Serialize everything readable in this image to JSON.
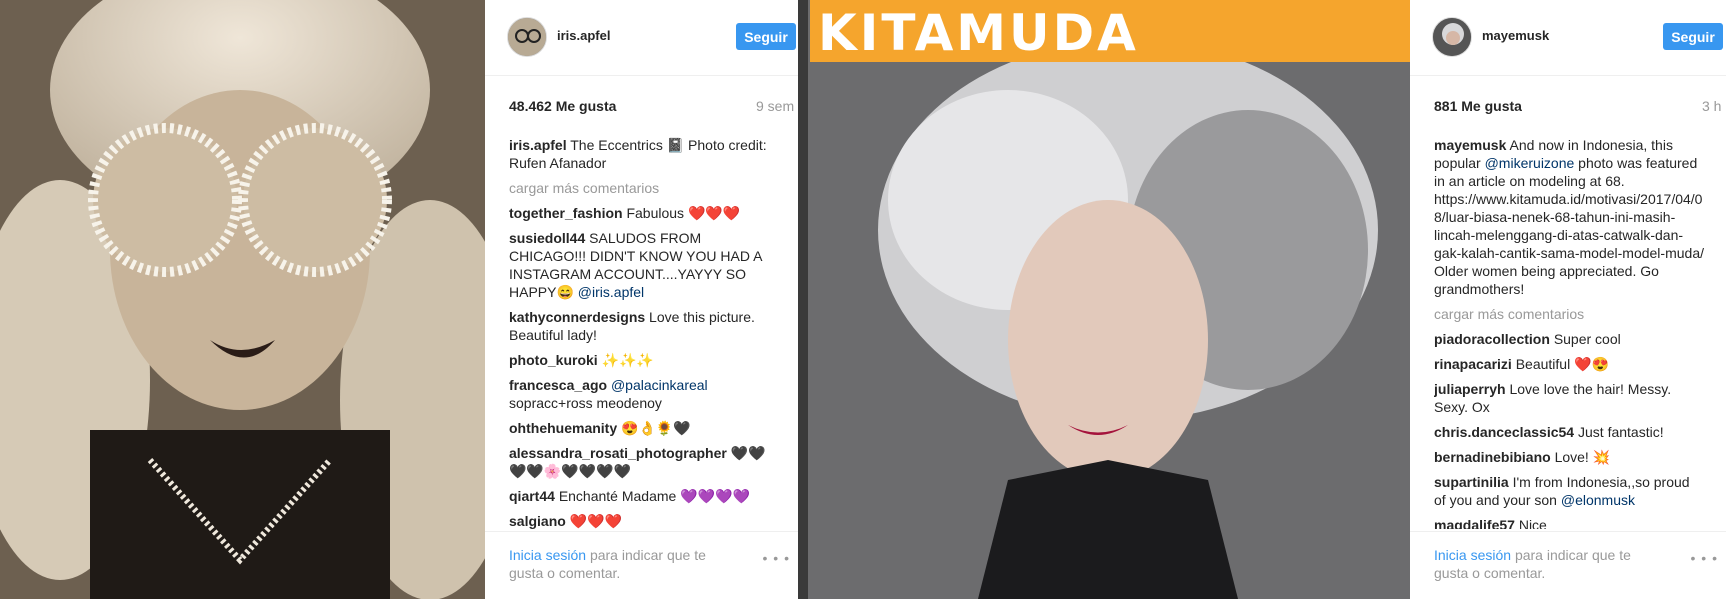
{
  "post1": {
    "username": "iris.apfel",
    "follow_label": "Seguir",
    "likes": "48.462 Me gusta",
    "time": "9 sem",
    "caption": {
      "user": "iris.apfel",
      "text": "The Eccentrics 📓 Photo credit: Rufen Afanador"
    },
    "load_more": "cargar más comentarios",
    "comments": [
      {
        "user": "together_fashion",
        "text": "Fabulous ❤️❤️❤️"
      },
      {
        "user": "susiedoll44",
        "text": "SALUDOS FROM CHICAGO!!! DIDN'T KNOW YOU HAD A INSTAGRAM ACCOUNT....YAYYY SO HAPPY😄",
        "mention": "@iris.apfel"
      },
      {
        "user": "kathyconnerdesigns",
        "text": "Love this picture. Beautiful lady!"
      },
      {
        "user": "photo_kuroki",
        "text": "✨✨✨"
      },
      {
        "user": "francesca_ago",
        "mention": "@palacinkareal",
        "text": "sopracc+ross meodenoy"
      },
      {
        "user": "ohthehuemanity",
        "text": "😍👌🌻🖤"
      },
      {
        "user": "alessandra_rosati_photographer",
        "text": "🖤🖤🖤🖤🌸🖤🖤🖤🖤"
      },
      {
        "user": "qiart44",
        "text": "Enchanté Madame 💜💜💜💜"
      },
      {
        "user": "salgiano",
        "text": "❤️❤️❤️"
      }
    ],
    "footer": {
      "login_link": "Inicia sesión",
      "login_text": "para indicar que te gusta o comentar."
    }
  },
  "post2": {
    "banner_text": "KITAMUDA",
    "username": "mayemusk",
    "follow_label": "Seguir",
    "likes": "881 Me gusta",
    "time": "3 h",
    "caption": {
      "user": "mayemusk",
      "text_a": "And now in Indonesia, this popular",
      "mention": "@mikeruizone",
      "text_b": "photo was featured in an article on modeling at 68. https://www.kitamuda.id/motivasi/2017/04/08/luar-biasa-nenek-68-tahun-ini-masih-lincah-melenggang-di-atas-catwalk-dan-gak-kalah-cantik-sama-model-model-muda/ Older women being appreciated. Go grandmothers!"
    },
    "load_more": "cargar más comentarios",
    "comments": [
      {
        "user": "piadoracollection",
        "text": "Super cool"
      },
      {
        "user": "rinapacarizi",
        "text": "Beautiful ❤️😍"
      },
      {
        "user": "juliaperryh",
        "text": "Love love the hair! Messy. Sexy. Ox"
      },
      {
        "user": "chris.danceclassic54",
        "text": "Just fantastic!"
      },
      {
        "user": "bernadinebibiano",
        "text": "Love! 💥"
      },
      {
        "user": "supartinilia",
        "text": "I'm from Indonesia,,so proud of you and your son",
        "mention": "@elonmusk"
      },
      {
        "user": "magdalife57",
        "text": "Nice"
      }
    ],
    "footer": {
      "login_link": "Inicia sesión",
      "login_text": "para indicar que te gusta o comentar."
    }
  }
}
